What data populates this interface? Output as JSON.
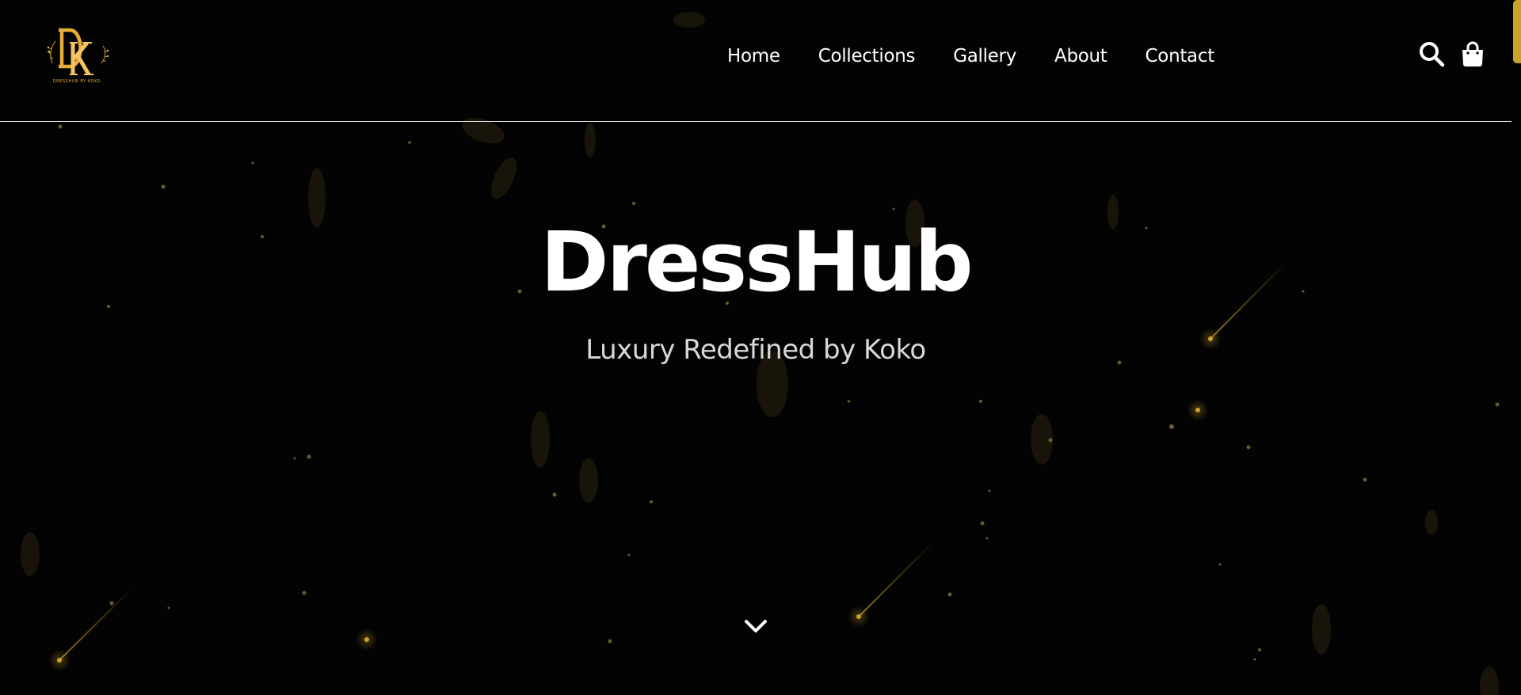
{
  "brand": {
    "logo_monogram": "DK",
    "logo_caption": "DRESSHUB BY KOKO",
    "accent_color": "#e8ae3a"
  },
  "nav": {
    "items": [
      {
        "label": "Home"
      },
      {
        "label": "Collections"
      },
      {
        "label": "Gallery"
      },
      {
        "label": "About"
      },
      {
        "label": "Contact"
      }
    ]
  },
  "header_icons": {
    "search": "search-icon",
    "bag": "shopping-bag-icon"
  },
  "hero": {
    "title": "DressHub",
    "subtitle": "Luxury Redefined by Koko",
    "scroll_icon": "chevron-down-icon"
  }
}
